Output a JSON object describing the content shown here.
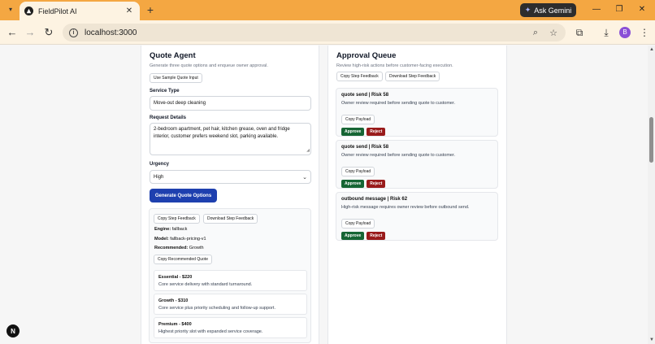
{
  "browser": {
    "tab_title": "FieldPilot AI",
    "tab_close": "✕",
    "new_tab": "+",
    "gemini_label": "Ask Gemini",
    "url": "localhost:3000",
    "profile_initial": "B",
    "icons": [
      "tab-search-icon",
      "favicon-icon",
      "close-icon",
      "plus-icon",
      "gemini-icon",
      "minimize-icon",
      "restore-icon",
      "close-window-icon",
      "back-icon",
      "forward-icon",
      "reload-icon",
      "site-info-icon",
      "zoom-icon",
      "bookmark-star-icon",
      "extensions-icon",
      "download-icon",
      "menu-icon"
    ]
  },
  "quote_agent": {
    "title": "Quote Agent",
    "subtitle": "Generate three quote options and enqueue owner approval.",
    "sample_button": "Use Sample Quote Input",
    "service_type_label": "Service Type",
    "service_type_value": "Move-out deep cleaning",
    "request_details_label": "Request Details",
    "request_details_value": "2-bedroom apartment, pet hair, kitchen grease, oven and fridge interior, customer prefers weekend slot, parking available.",
    "urgency_label": "Urgency",
    "urgency_value": "High",
    "generate_button": "Generate Quote Options",
    "copy_feedback": "Copy Step Feedback",
    "download_feedback": "Download Step Feedback",
    "engine_label": "Engine:",
    "engine_value": "fallback",
    "model_label": "Model:",
    "model_value": "fallback-pricing-v1",
    "recommended_label": "Recommended:",
    "recommended_value": "Growth",
    "copy_recommended": "Copy Recommended Quote",
    "options": [
      {
        "title": "Essential - $220",
        "desc": "Core service delivery with standard turnaround."
      },
      {
        "title": "Growth - $310",
        "desc": "Core service plus priority scheduling and follow-up support."
      },
      {
        "title": "Premium - $400",
        "desc": "Highest priority slot with expanded service coverage."
      }
    ]
  },
  "approval_queue": {
    "title": "Approval Queue",
    "subtitle": "Review high-risk actions before customer-facing execution.",
    "copy_feedback": "Copy Step Feedback",
    "download_feedback": "Download Step Feedback",
    "items": [
      {
        "title": "quote send | Risk 58",
        "desc": "Owner review required before sending quote to customer.",
        "copy": "Copy Payload",
        "approve": "Approve",
        "reject": "Reject"
      },
      {
        "title": "quote send | Risk 58",
        "desc": "Owner review required before sending quote to customer.",
        "copy": "Copy Payload",
        "approve": "Approve",
        "reject": "Reject"
      },
      {
        "title": "outbound message | Risk 62",
        "desc": "High-risk message requires owner review before outbound send.",
        "copy": "Copy Payload",
        "approve": "Approve",
        "reject": "Reject"
      }
    ]
  },
  "next_badge": "N",
  "colors": {
    "tabbar": "#f4a742",
    "primary": "#1e40af",
    "approve": "#166534",
    "reject": "#991b1b"
  }
}
